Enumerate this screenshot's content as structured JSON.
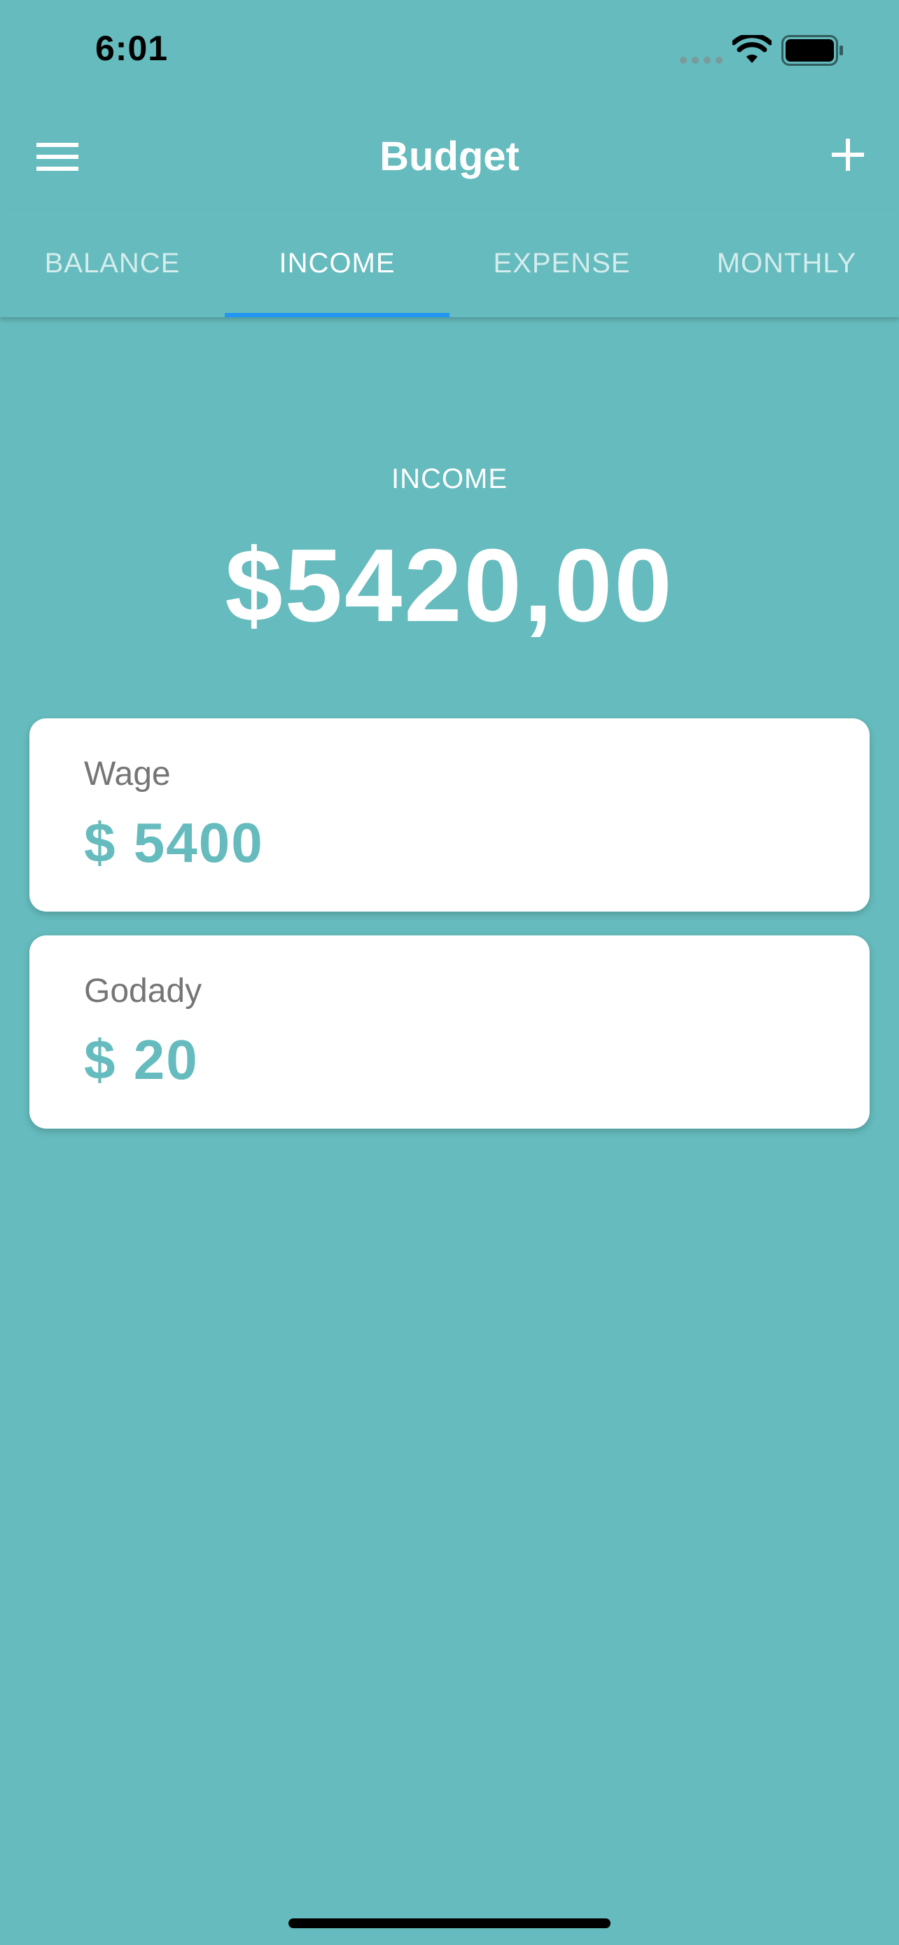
{
  "status_bar": {
    "time": "6:01"
  },
  "app_bar": {
    "title": "Budget"
  },
  "tabs": [
    {
      "label": "BALANCE",
      "active": false
    },
    {
      "label": "INCOME",
      "active": true
    },
    {
      "label": "EXPENSE",
      "active": false
    },
    {
      "label": "MONTHLY",
      "active": false
    }
  ],
  "summary": {
    "label": "INCOME",
    "amount": "$5420,00"
  },
  "items": [
    {
      "name": "Wage",
      "amount": "$ 5400"
    },
    {
      "name": "Godady",
      "amount": "$ 20"
    }
  ],
  "colors": {
    "background": "#65BBBD",
    "tab_indicator": "#2196F3",
    "card_background": "#FFFFFF",
    "card_amount": "#65BBBD",
    "card_name": "#757575"
  },
  "icons": {
    "menu": "menu-icon",
    "add": "add-icon",
    "wifi": "wifi-icon",
    "battery": "battery-icon",
    "signal": "signal-dots-icon"
  }
}
